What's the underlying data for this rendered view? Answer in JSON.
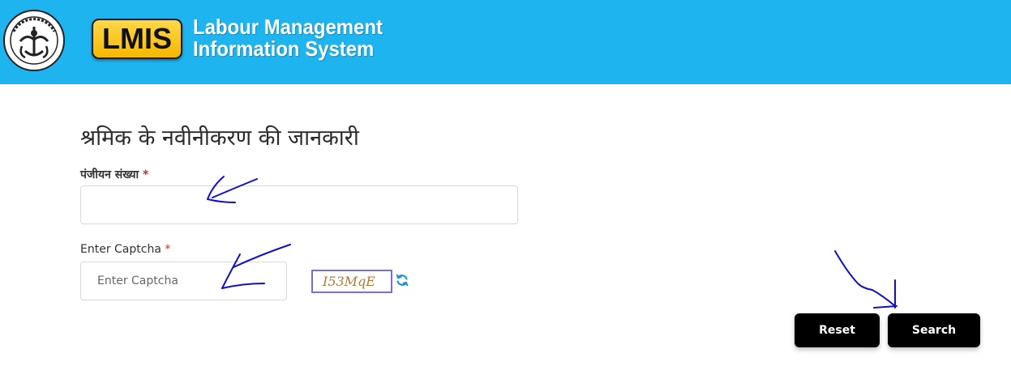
{
  "header": {
    "logo_text": "LMIS",
    "title_line1": "Labour Management",
    "title_line2": "Information System",
    "emblem_seal_text": "उत्तर प्रदेश सरकार",
    "bg_color": "#1eb4ef"
  },
  "form": {
    "page_title": "श्रमिक के नवीनीकरण की जानकारी",
    "registration": {
      "label": "पंजीयन संख्या",
      "required_mark": "*",
      "value": "",
      "placeholder": ""
    },
    "captcha": {
      "label": "Enter Captcha",
      "required_mark": "*",
      "value": "",
      "placeholder": "Enter Captcha",
      "code": "I53MqE",
      "refresh_icon": "refresh-icon"
    },
    "buttons": {
      "reset_label": "Reset",
      "search_label": "Search",
      "button_color": "#000000"
    }
  },
  "annotations": {
    "pen_color": "#1010c8",
    "icon": "hand-drawn-arrow"
  }
}
